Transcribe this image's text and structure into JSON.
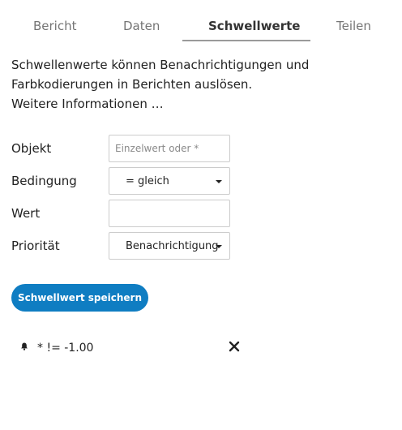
{
  "tabs": [
    {
      "label": "Bericht"
    },
    {
      "label": "Daten"
    },
    {
      "label": "Schwellwerte"
    },
    {
      "label": "Teilen"
    }
  ],
  "active_tab": "Schwellwerte",
  "description": {
    "text": "Schwellenwerte können Benachrichtigungen und Farbkodierungen in Berichten auslösen.",
    "more_link": "Weitere Informationen …"
  },
  "form": {
    "object_label": "Objekt",
    "object_placeholder": "Einzelwert oder *",
    "condition_label": "Bedingung",
    "condition_value": "= gleich",
    "value_label": "Wert",
    "value_value": "",
    "priority_label": "Priorität",
    "priority_value": "Benachrichtigung",
    "save_label": "Schwellwert speichern"
  },
  "thresholds": [
    {
      "text": "* != -1.00",
      "icon": "bell-icon"
    }
  ],
  "colors": {
    "accent": "#0f7dc2",
    "active_tab_underline": "#9a9a9a"
  }
}
